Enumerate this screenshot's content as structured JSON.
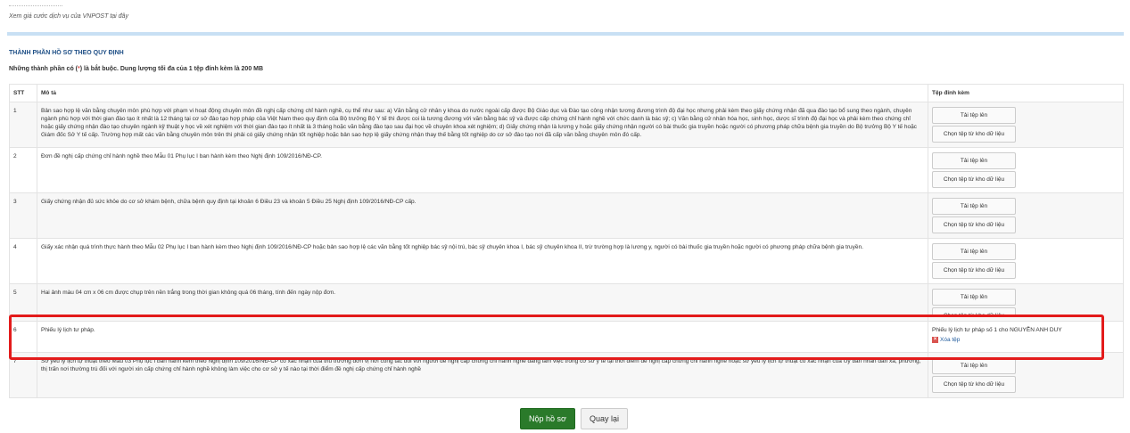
{
  "top": {
    "link_text": "Xem giá cước dịch vụ của VNPOST tại đây"
  },
  "section": {
    "title": "THÀNH PHẦN HỒ SƠ THEO QUY ĐỊNH",
    "note_prefix": "Những thành phần có (",
    "note_required": "*",
    "note_suffix": ") là bắt buộc. Dung lượng tối đa của 1 tệp đính kèm là 200 MB"
  },
  "table": {
    "headers": {
      "stt": "STT",
      "desc": "Mô tả",
      "file": "Tệp đính kèm"
    },
    "upload_label": "Tải tệp lên",
    "choose_label": "Chọn tệp từ kho dữ liệu",
    "rows": [
      {
        "stt": "1",
        "desc": "Bản sao hợp lệ văn bằng chuyên môn phù hợp với phạm vi hoạt động chuyên môn đề nghị cấp chứng chỉ hành nghề, cụ thể như sau: a) Văn bằng cử nhân y khoa do nước ngoài cấp được Bộ Giáo dục và Đào tạo công nhận tương đương trình độ đại học nhưng phải kèm theo giấy chứng nhận đã qua đào tạo bổ sung theo ngành, chuyên ngành phù hợp với thời gian đào tạo ít nhất là 12 tháng tại cơ sở đào tạo hợp pháp của Việt Nam theo quy định của Bộ trưởng Bộ Y tế thì được coi là tương đương với văn bằng bác sỹ và được cấp chứng chỉ hành nghề với chức danh là bác sỹ; c) Văn bằng cử nhân hóa học, sinh học, dược sĩ trình độ đại học và phải kèm theo chứng chỉ hoặc giấy chứng nhận đào tạo chuyên ngành kỹ thuật y học về xét nghiệm với thời gian đào tạo ít nhất là 3 tháng hoặc văn bằng đào tạo sau đại học về chuyên khoa xét nghiệm; d) Giấy chứng nhận là lương y hoặc giấy chứng nhận người có bài thuốc gia truyền hoặc người có phương pháp chữa bệnh gia truyền do Bộ trưởng Bộ Y tế hoặc Giám đốc Sở Y tế cấp. Trường hợp mất các văn bằng chuyên môn trên thì phải có giấy chứng nhận tốt nghiệp hoặc bản sao hợp lệ giấy chứng nhận thay thế bằng tốt nghiệp do cơ sở đào tạo nơi đã cấp văn bằng chuyên môn đó cấp."
      },
      {
        "stt": "2",
        "desc": "Đơn đề nghị cấp chứng chỉ hành nghề theo Mẫu 01 Phụ lục I ban hành kèm theo Nghị định 109/2016/NĐ-CP."
      },
      {
        "stt": "3",
        "desc": "Giấy chứng nhận đủ sức khỏe do cơ sở khám bệnh, chữa bệnh quy định tại khoản 6 Điều 23 và khoản 5 Điều 25 Nghị định 109/2016/NĐ-CP cấp."
      },
      {
        "stt": "4",
        "desc": "Giấy xác nhận quá trình thực hành theo Mẫu 02 Phụ lục I ban hành kèm theo Nghị định 109/2016/NĐ-CP hoặc bản sao hợp lệ các văn bằng tốt nghiệp bác sỹ nội trú, bác sỹ chuyên khoa I, bác sỹ chuyên khoa II, trừ trường hợp là lương y, người có bài thuốc gia truyền hoặc người có phương pháp chữa bệnh gia truyền."
      },
      {
        "stt": "5",
        "desc": "Hai ảnh màu 04 cm x 06 cm được chụp trên nền trắng trong thời gian không quá 06 tháng, tính đến ngày nộp đơn."
      },
      {
        "stt": "6",
        "desc": "Phiếu lý lịch tư pháp.",
        "attached": "Phiếu lý lịch tư pháp số 1 cho NGUYỄN ANH DUY",
        "delete_label": "Xóa tệp"
      },
      {
        "stt": "7",
        "desc": "Sơ yếu lý lịch tự thuật theo Mẫu 03 Phụ lục I ban hành kèm theo Nghị định 109/2016/NĐ-CP có xác nhận của thủ trưởng đơn vị nơi công tác đối với người đề nghị cấp chứng chỉ hành nghề đang làm việc trong cơ sở y tế tại thời điểm đề nghị cấp chứng chỉ hành nghề hoặc sơ yếu lý lịch tự thuật có xác nhận của Ủy ban nhân dân xã, phường, thị trấn nơi thường trú đối với người xin cấp chứng chỉ hành nghề không làm việc cho cơ sở y tế nào tại thời điểm đề nghị cấp chứng chỉ hành nghề"
      }
    ]
  },
  "actions": {
    "submit_label": "Nộp hồ sơ",
    "back_label": "Quay lại"
  },
  "colors": {
    "submit": "#2a7a2a",
    "highlight": "#e31b1b",
    "section_title": "#1e4f86",
    "delete_icon": "#d9534f"
  }
}
